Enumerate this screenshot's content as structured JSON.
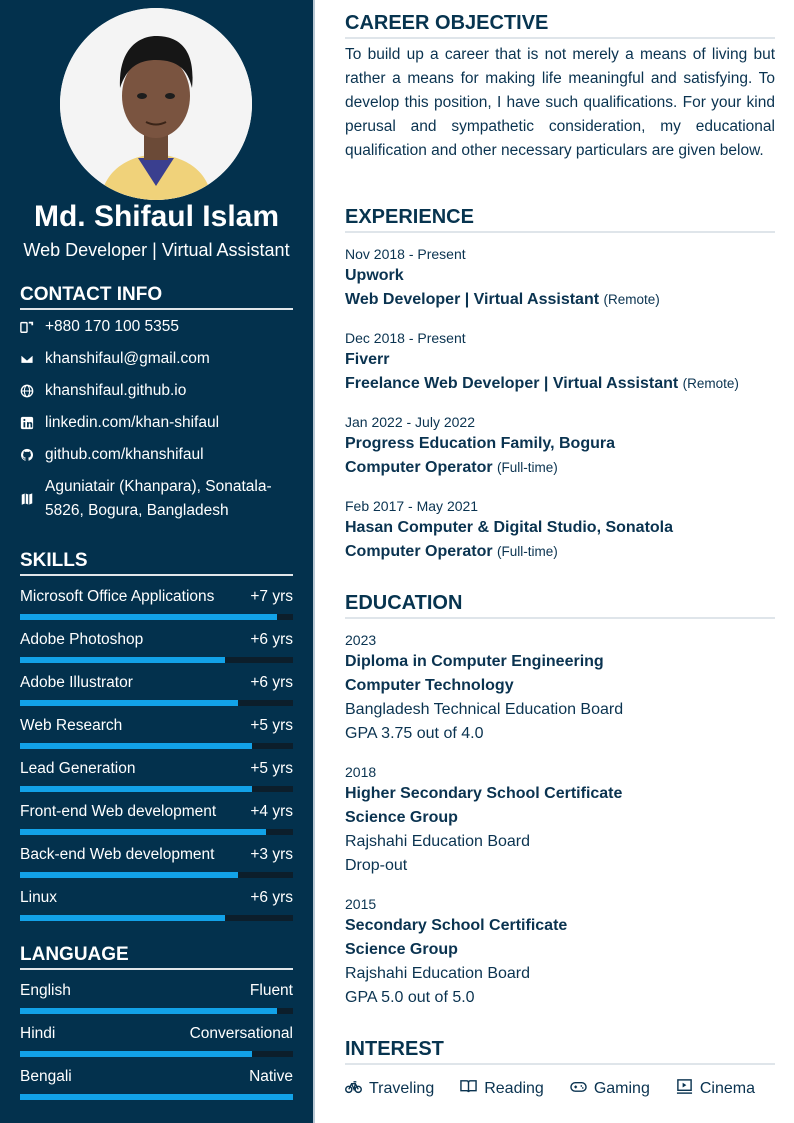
{
  "profile": {
    "name": "Md. Shifaul Islam",
    "title": "Web Developer | Virtual Assistant"
  },
  "contact": {
    "heading": "CONTACT INFO",
    "items": [
      {
        "icon": "phone-icon",
        "text": "+880 170 100 5355"
      },
      {
        "icon": "email-icon",
        "text": "khanshifaul@gmail.com"
      },
      {
        "icon": "globe-icon",
        "text": "khanshifaul.github.io"
      },
      {
        "icon": "linkedin-icon",
        "text": "linkedin.com/khan-shifaul"
      },
      {
        "icon": "github-icon",
        "text": "github.com/khanshifaul"
      },
      {
        "icon": "map-icon",
        "line1": "Aguniatair (Khanpara), Sonatala-",
        "line2": "5826, Bogura, Bangladesh"
      }
    ]
  },
  "skills": {
    "heading": "SKILLS",
    "items": [
      {
        "name": "Microsoft Office Applications",
        "years": "+7 yrs",
        "level": 0.94
      },
      {
        "name": "Adobe Photoshop",
        "years": "+6 yrs",
        "level": 0.75
      },
      {
        "name": "Adobe Illustrator",
        "years": "+6 yrs",
        "level": 0.8
      },
      {
        "name": "Web Research",
        "years": "+5 yrs",
        "level": 0.85
      },
      {
        "name": "Lead Generation",
        "years": "+5 yrs",
        "level": 0.85
      },
      {
        "name": "Front-end Web development",
        "years": "+4 yrs",
        "level": 0.9
      },
      {
        "name": "Back-end Web development",
        "years": "+3 yrs",
        "level": 0.8
      },
      {
        "name": "Linux",
        "years": "+6 yrs",
        "level": 0.75
      }
    ]
  },
  "languages": {
    "heading": "LANGUAGE",
    "items": [
      {
        "name": "English",
        "level_text": "Fluent",
        "level": 0.94
      },
      {
        "name": "Hindi",
        "level_text": "Conversational",
        "level": 0.85
      },
      {
        "name": "Bengali",
        "level_text": "Native",
        "level": 1.0
      }
    ]
  },
  "objective": {
    "heading": "CAREER OBJECTIVE",
    "text": "To build up a career that is not merely a means of living but rather a means for making life meaningful and satisfying. To develop this position, I have such qualifications. For your kind perusal and sympathetic consideration, my educational qualification and other necessary particulars are given below."
  },
  "experience": {
    "heading": "EXPERIENCE",
    "items": [
      {
        "date": "Nov 2018 - Present",
        "org": "Upwork",
        "role": "Web Developer | Virtual Assistant",
        "type": "(Remote)"
      },
      {
        "date": "Dec 2018 - Present",
        "org": "Fiverr",
        "role": "Freelance Web Developer | Virtual Assistant",
        "type": "(Remote)"
      },
      {
        "date": "Jan 2022 - July 2022",
        "org": "Progress Education Family, Bogura",
        "role": "Computer Operator",
        "type": "(Full-time)"
      },
      {
        "date": "Feb 2017 - May 2021",
        "org": "Hasan Computer & Digital Studio, Sonatola",
        "role": "Computer Operator",
        "type": "(Full-time)"
      }
    ]
  },
  "education": {
    "heading": "EDUCATION",
    "items": [
      {
        "year": "2023",
        "degree": "Diploma in Computer Engineering",
        "field": "Computer Technology",
        "board": "Bangladesh Technical Education Board",
        "result": "GPA 3.75 out of 4.0"
      },
      {
        "year": "2018",
        "degree": "Higher Secondary School Certificate",
        "field": "Science Group",
        "board": "Rajshahi Education Board",
        "result": "Drop-out"
      },
      {
        "year": "2015",
        "degree": "Secondary School Certificate",
        "field": "Science Group",
        "board": "Rajshahi Education Board",
        "result": "GPA 5.0 out of 5.0"
      }
    ]
  },
  "interest": {
    "heading": "INTEREST",
    "items": [
      {
        "icon": "bicycle-icon",
        "label": "Traveling"
      },
      {
        "icon": "book-icon",
        "label": "Reading"
      },
      {
        "icon": "gamepad-icon",
        "label": "Gaming"
      },
      {
        "icon": "cinema-icon",
        "label": "Cinema"
      }
    ]
  },
  "colors": {
    "sidebar": "#03314d",
    "accent": "#12a2e8",
    "heading": "#07344f"
  }
}
